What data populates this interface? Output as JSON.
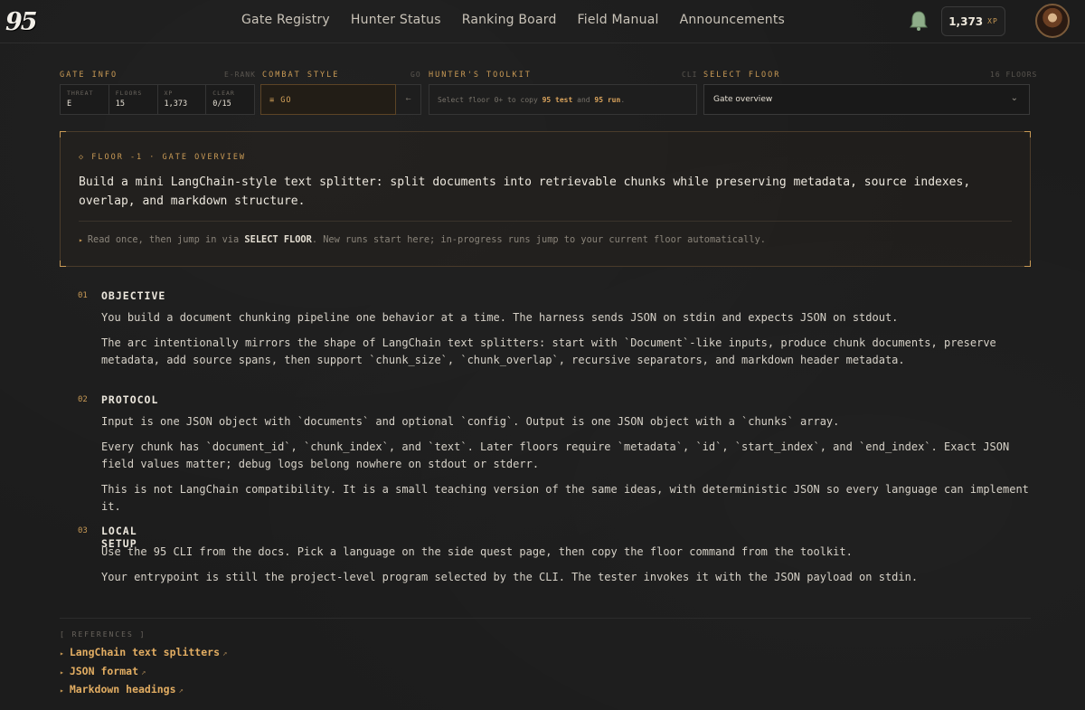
{
  "logo": "95",
  "nav": [
    "Gate Registry",
    "Hunter Status",
    "Ranking Board",
    "Field Manual",
    "Announcements"
  ],
  "header": {
    "xp_value": "1,373",
    "xp_unit": "XP"
  },
  "gate_info": {
    "label": "GATE INFO",
    "rank": "E-RANK",
    "cells": [
      {
        "k": "THREAT",
        "v": "E"
      },
      {
        "k": "FLOORS",
        "v": "15"
      },
      {
        "k": "XP",
        "v": "1,373"
      },
      {
        "k": "CLEAR",
        "v": "0/15"
      }
    ]
  },
  "combat": {
    "label": "COMBAT STYLE",
    "meta": "GO",
    "value": "≡ GO",
    "arrow": "←"
  },
  "toolkit": {
    "label": "HUNTER'S TOOLKIT",
    "meta": "CLI",
    "text_a": "Select floor 0+ to copy ",
    "cmd_test": "95 test",
    "text_b": " and ",
    "cmd_run": "95 run",
    "text_c": "."
  },
  "select_floor": {
    "label": "SELECT FLOOR",
    "meta": "16 FLOORS",
    "value": "Gate overview"
  },
  "overview": {
    "tag": "◇ FLOOR -1 · GATE OVERVIEW",
    "main": "Build a mini LangChain-style text splitter: split documents into retrievable chunks while preserving metadata, source indexes, overlap, and markdown structure.",
    "hint_a": "Read once, then jump in via ",
    "hint_b": "SELECT FLOOR",
    "hint_c": ". New runs start here; in-progress runs jump to your current floor automatically."
  },
  "sections": [
    {
      "num": "01",
      "title": "OBJECTIVE",
      "paras": [
        "You build a document chunking pipeline one behavior at a time. The harness sends JSON on stdin and expects JSON on stdout.",
        "The arc intentionally mirrors the shape of LangChain text splitters: start with `Document`-like inputs, produce chunk documents, preserve metadata, add source spans, then support `chunk_size`, `chunk_overlap`, recursive separators, and markdown header metadata."
      ]
    },
    {
      "num": "02",
      "title": "PROTOCOL",
      "paras": [
        "Input is one JSON object with `documents` and optional `config`. Output is one JSON object with a `chunks` array.",
        "Every chunk has `document_id`, `chunk_index`, and `text`. Later floors require `metadata`, `id`, `start_index`, and `end_index`. Exact JSON field values matter; debug logs belong nowhere on stdout or stderr.",
        "This is not LangChain compatibility. It is a small teaching version of the same ideas, with deterministic JSON so every language can implement it."
      ]
    },
    {
      "num": "03",
      "title": "LOCAL SETUP",
      "paras": [
        "Use the 95 CLI from the docs. Pick a language on the side quest page, then copy the floor command from the toolkit.",
        "Your entrypoint is still the project-level program selected by the CLI. The tester invokes it with the JSON payload on stdin."
      ]
    }
  ],
  "references": {
    "label": "[ REFERENCES ]",
    "items": [
      "LangChain text splitters",
      "JSON format",
      "Markdown headings"
    ]
  }
}
